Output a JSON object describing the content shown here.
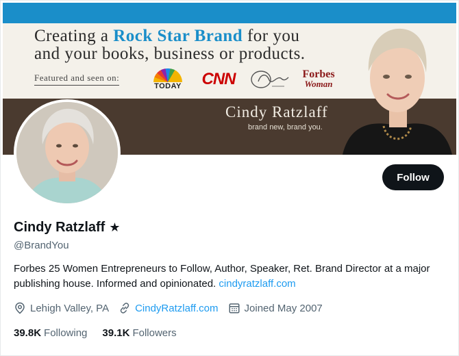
{
  "banner": {
    "tagline_pre": "Creating a ",
    "tagline_accent": "Rock Star Brand",
    "tagline_post": " for you",
    "tagline_line2": "and your books, business or products.",
    "featured_label": "Featured and seen on:",
    "logos": {
      "today": "TODAY",
      "cnn": "CNN",
      "forbes_line1": "Forbes",
      "forbes_line2": "Woman"
    },
    "name": "Cindy Ratzlaff",
    "subline": "brand new, brand you."
  },
  "profile": {
    "display_name": "Cindy Ratzlaff",
    "badge": "★",
    "handle": "@BrandYou",
    "bio_text": "Forbes 25 Women Entrepreneurs to Follow, Author, Speaker, Ret. Brand Director at a major publishing house. Informed and opinionated. ",
    "bio_link": "cindyratzlaff.com",
    "location": "Lehigh Valley, PA",
    "website": "CindyRatzlaff.com",
    "joined": "Joined May 2007",
    "following_count": "39.8K",
    "following_label": "Following",
    "followers_count": "39.1K",
    "followers_label": "Followers"
  },
  "actions": {
    "follow_label": "Follow"
  },
  "colors": {
    "accent": "#1d9bf0",
    "banner_top": "#1a8ec9",
    "banner_dark": "#4a3a2f",
    "text": "#0f1419",
    "muted": "#536471"
  },
  "icons": {
    "location": "map-pin-icon",
    "website": "link-icon",
    "joined": "calendar-icon",
    "verified": "star-icon"
  }
}
